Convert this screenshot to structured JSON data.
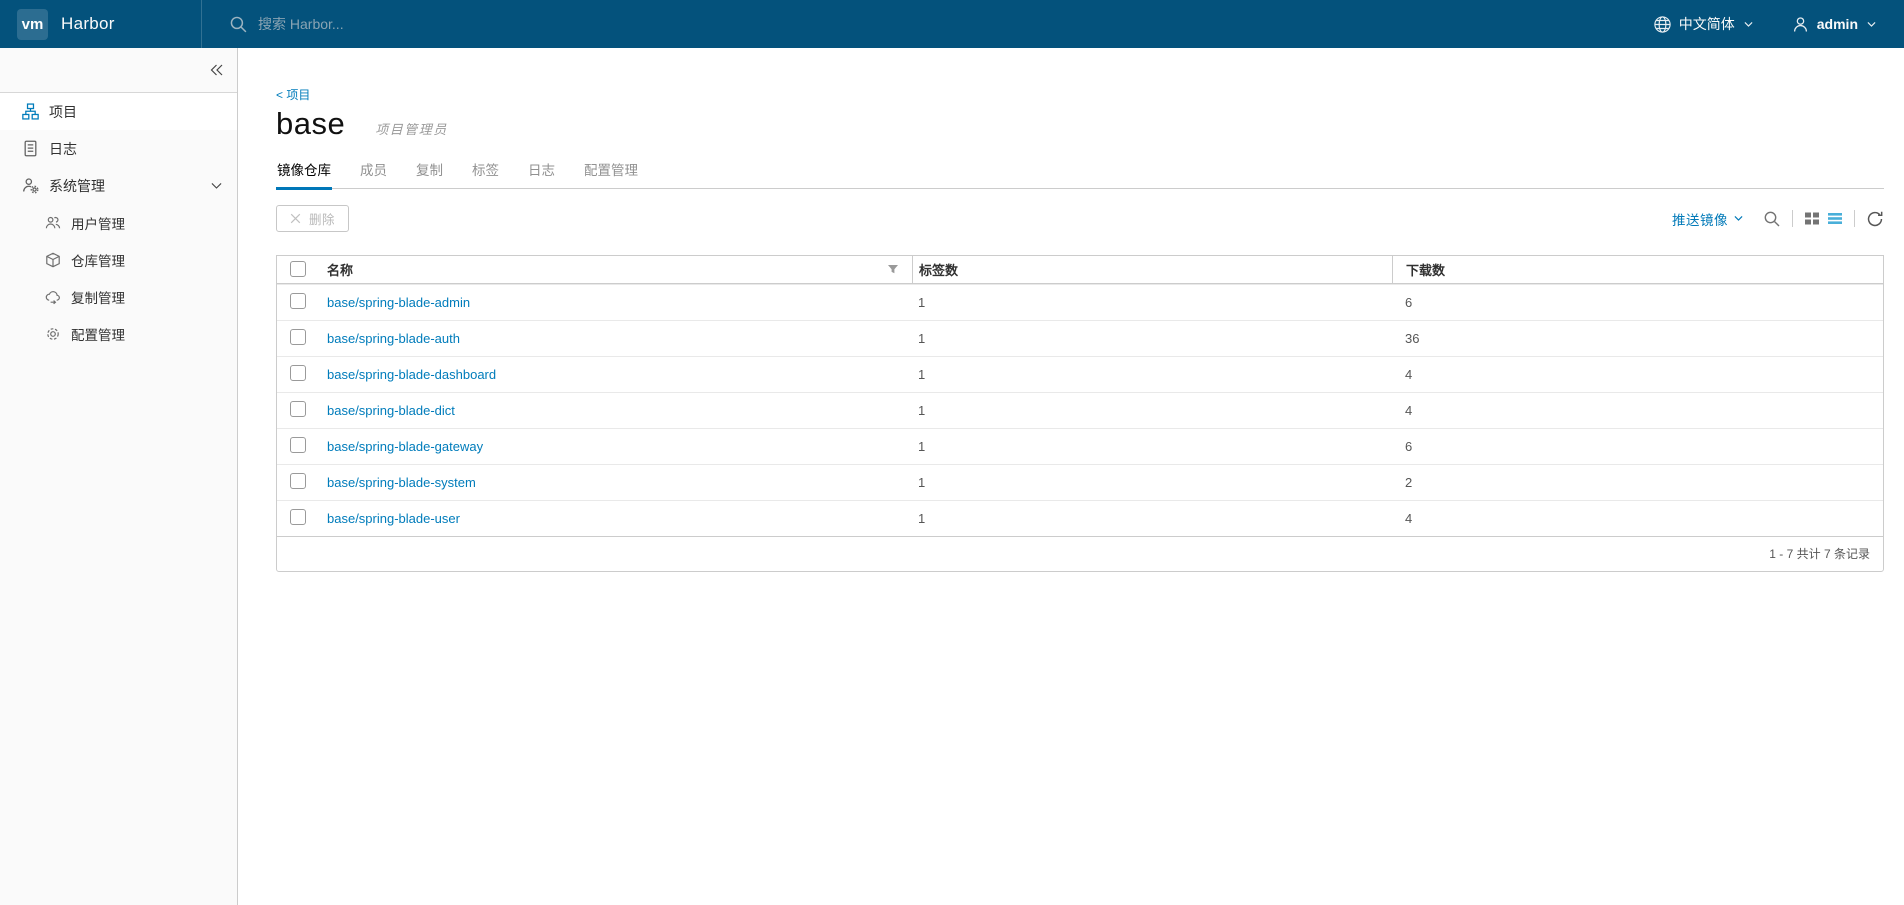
{
  "colors": {
    "header_bg": "#04527c",
    "accent_blue": "#007cbb",
    "active_tab_underline": "#0077b8",
    "list_view_icon_blue": "#49afd9",
    "sidebar_bg": "#fafafa",
    "border": "#cccccc"
  },
  "icons": {
    "logo": "vm",
    "search-icon": "🔍",
    "globe-icon": "🌐",
    "user-icon": "👤",
    "caret-down-icon": "⌄",
    "collapse-icon": "«",
    "projects-icon": "organization-chart",
    "logs-icon": "list-document",
    "system-admin-icon": "user-gear",
    "users-icon": "users",
    "registry-icon": "cube",
    "replication-icon": "cloud-sync",
    "config-icon": "⚙",
    "x-icon": "✕",
    "filter-icon": "funnel",
    "grid-view-icon": "▦",
    "list-view-icon": "≡",
    "refresh-icon": "↻"
  },
  "header": {
    "logo_text": "vm",
    "app_name": "Harbor",
    "search_placeholder": "搜索 Harbor...",
    "language": "中文简体",
    "username": "admin"
  },
  "sidebar": {
    "items": [
      {
        "label": "项目",
        "icon": "projects-icon",
        "active": true
      },
      {
        "label": "日志",
        "icon": "logs-icon",
        "active": false
      },
      {
        "label": "系统管理",
        "icon": "system-admin-icon",
        "active": false,
        "expanded": true,
        "children": [
          {
            "label": "用户管理",
            "icon": "users-icon"
          },
          {
            "label": "仓库管理",
            "icon": "registry-icon"
          },
          {
            "label": "复制管理",
            "icon": "replication-icon"
          },
          {
            "label": "配置管理",
            "icon": "config-icon"
          }
        ]
      }
    ]
  },
  "main": {
    "breadcrumb": "< 项目",
    "title": "base",
    "role_badge": "项目管理员",
    "tabs": [
      {
        "label": "镜像仓库",
        "active": true
      },
      {
        "label": "成员",
        "active": false
      },
      {
        "label": "复制",
        "active": false
      },
      {
        "label": "标签",
        "active": false
      },
      {
        "label": "日志",
        "active": false
      },
      {
        "label": "配置管理",
        "active": false
      }
    ],
    "toolbar": {
      "delete_label": "删除",
      "push_image_label": "推送镜像"
    },
    "table": {
      "columns": [
        "名称",
        "标签数",
        "下载数"
      ],
      "rows": [
        {
          "name": "base/spring-blade-admin",
          "tags": "1",
          "downloads": "6"
        },
        {
          "name": "base/spring-blade-auth",
          "tags": "1",
          "downloads": "36"
        },
        {
          "name": "base/spring-blade-dashboard",
          "tags": "1",
          "downloads": "4"
        },
        {
          "name": "base/spring-blade-dict",
          "tags": "1",
          "downloads": "4"
        },
        {
          "name": "base/spring-blade-gateway",
          "tags": "1",
          "downloads": "6"
        },
        {
          "name": "base/spring-blade-system",
          "tags": "1",
          "downloads": "2"
        },
        {
          "name": "base/spring-blade-user",
          "tags": "1",
          "downloads": "4"
        }
      ],
      "footer": "1 - 7 共计 7 条记录"
    }
  }
}
